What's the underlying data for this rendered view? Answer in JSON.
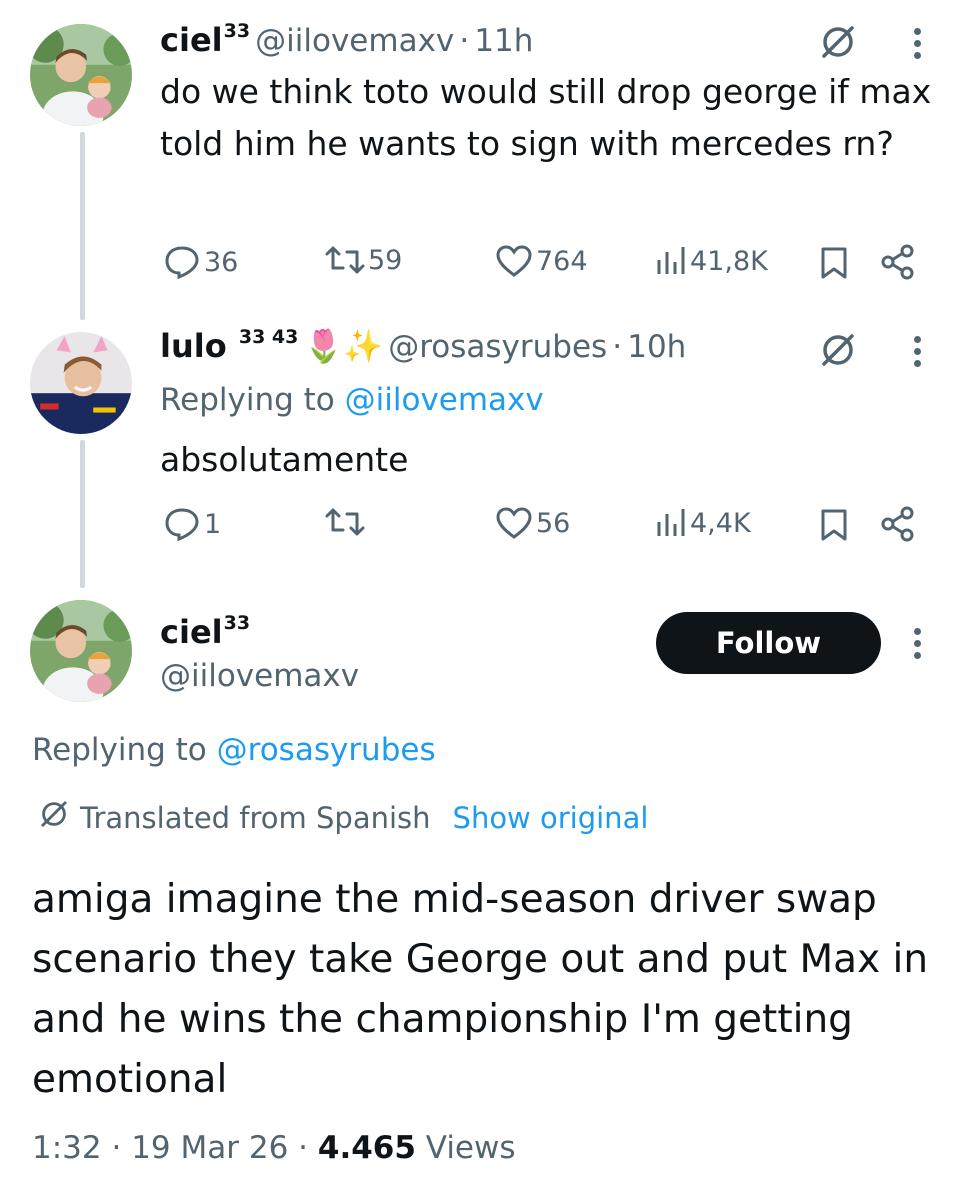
{
  "tweet1": {
    "name": "ciel",
    "name_sup": "33",
    "handle": "@iilovemaxv",
    "time": "11h",
    "text": "do we think toto would still drop george if max told him he wants to sign with mercedes rn?",
    "replies": "36",
    "retweets": "59",
    "likes": "764",
    "views": "41,8K"
  },
  "tweet2": {
    "name": "lulo",
    "name_sup": "33 43",
    "emoji": "🌷✨",
    "handle": "@rosasyrubes",
    "time": "10h",
    "replying_prefix": "Replying to",
    "replying_handle": "@iilovemaxv",
    "text": "absolutamente",
    "replies": "1",
    "retweets": "",
    "likes": "56",
    "views": "4,4K"
  },
  "main": {
    "name": "ciel",
    "name_sup": "33",
    "handle": "@iilovemaxv",
    "follow_label": "Follow",
    "replying_prefix": "Replying to",
    "replying_handle": "@rosasyrubes",
    "translated_label": "Translated from Spanish",
    "show_original_label": "Show original",
    "text": "amiga imagine the mid-season driver swap scenario they take George out and put Max in and he wins the championship I'm getting emotional",
    "time": "1:32",
    "date": "19 Mar 26",
    "views_count": "4.465",
    "views_label": "Views"
  },
  "separator": "·",
  "icons": [
    "reply-icon",
    "retweet-icon",
    "like-icon",
    "views-icon",
    "bookmark-icon",
    "share-icon",
    "grok-icon",
    "more-icon",
    "translate-icon"
  ],
  "colors": {
    "link": "#1d9bf0",
    "secondary": "#536471",
    "text": "#0f1419",
    "thread_line": "#cfd9de"
  }
}
